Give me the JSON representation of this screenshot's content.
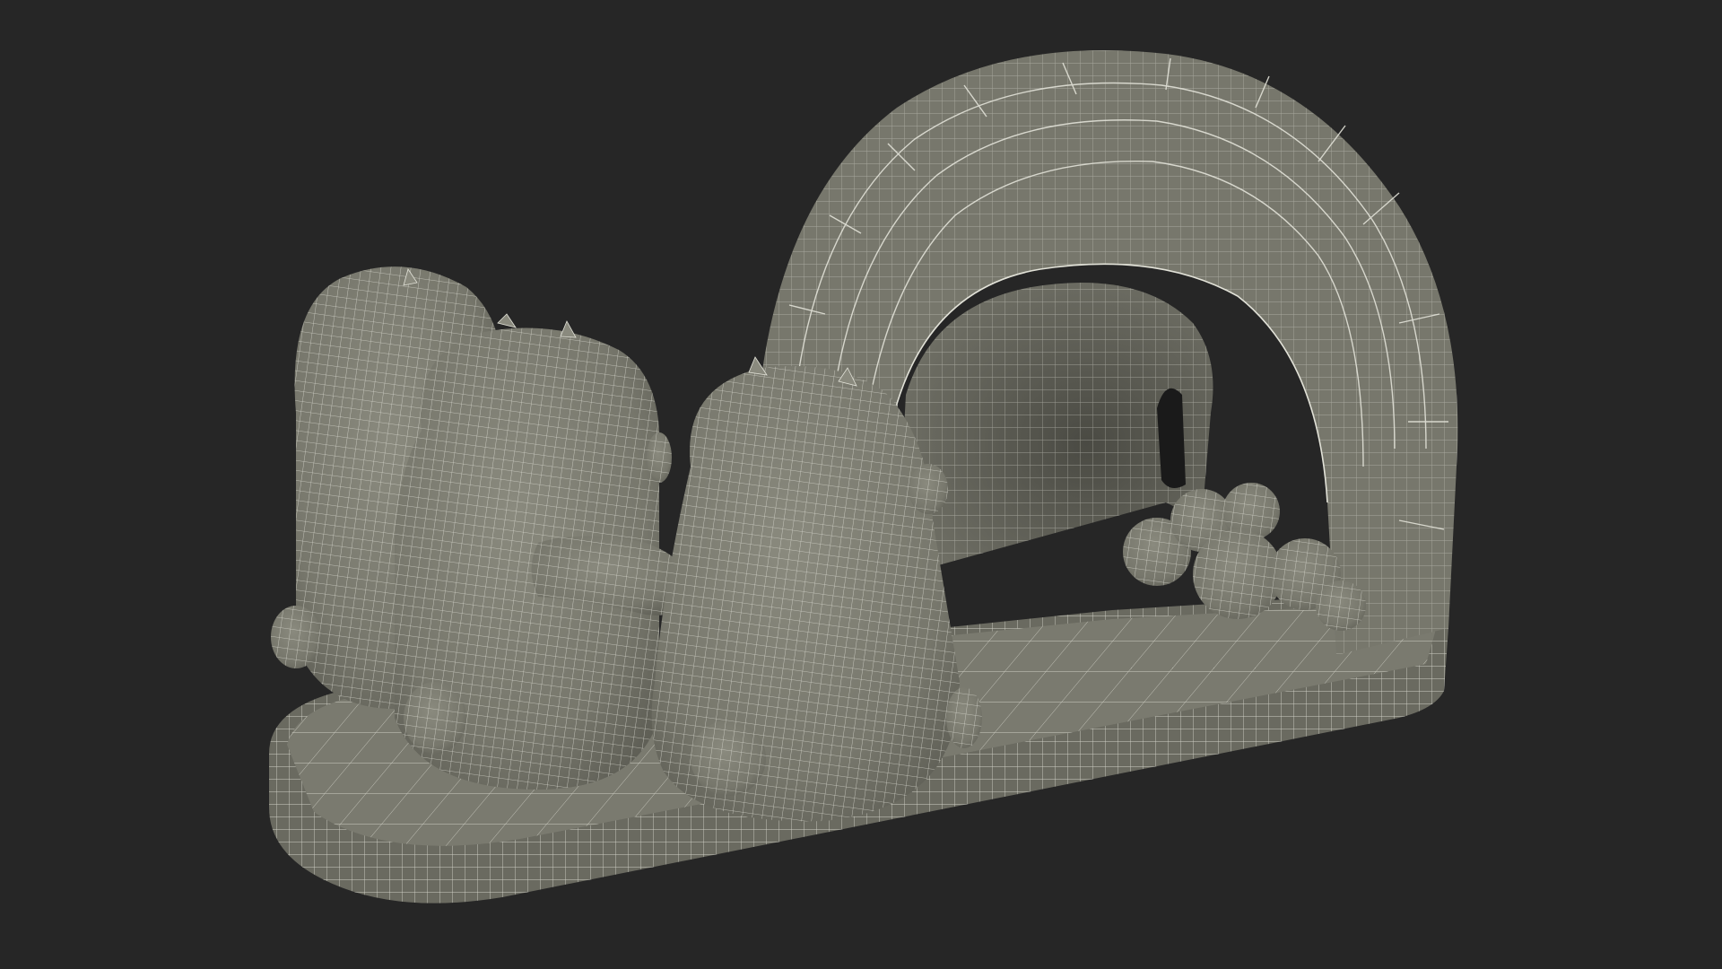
{
  "scene": {
    "background_color": "#262626",
    "surface_color": "#77776c",
    "surface_shadow_color": "#56564e",
    "surface_highlight_color": "#8a8a7e",
    "wire_color": "#e2e2d8",
    "objects": [
      "base-platform",
      "igloo-arch",
      "bear-left",
      "bear-middle",
      "bear-front",
      "snow-rocks"
    ]
  }
}
